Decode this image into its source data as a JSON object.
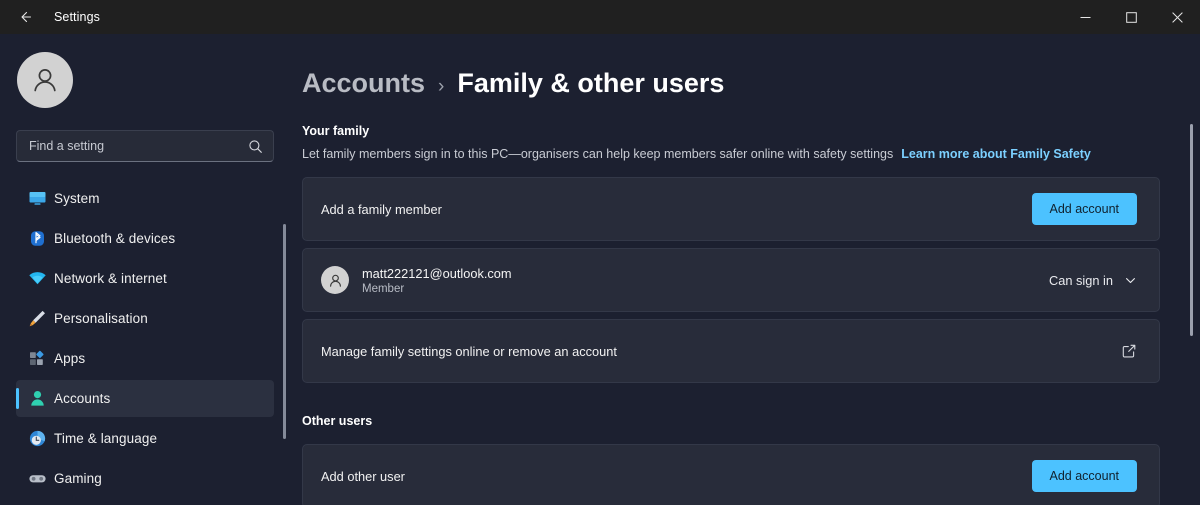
{
  "titlebar": {
    "back_label": "Back",
    "app_title": "Settings",
    "minimize_label": "—",
    "maximize_label": "☐",
    "close_label": "✕"
  },
  "sidebar": {
    "avatar_name": "user-avatar",
    "search": {
      "placeholder": "Find a setting",
      "value": ""
    },
    "items": [
      {
        "label": "System",
        "icon": "system-icon",
        "selected": false
      },
      {
        "label": "Bluetooth & devices",
        "icon": "bluetooth-icon",
        "selected": false
      },
      {
        "label": "Network & internet",
        "icon": "network-icon",
        "selected": false
      },
      {
        "label": "Personalisation",
        "icon": "personalisation-icon",
        "selected": false
      },
      {
        "label": "Apps",
        "icon": "apps-icon",
        "selected": false
      },
      {
        "label": "Accounts",
        "icon": "accounts-icon",
        "selected": true
      },
      {
        "label": "Time & language",
        "icon": "time-icon",
        "selected": false
      },
      {
        "label": "Gaming",
        "icon": "gaming-icon",
        "selected": false
      }
    ]
  },
  "main": {
    "breadcrumb": {
      "parent": "Accounts",
      "separator": "›",
      "current": "Family & other users"
    },
    "your_family": {
      "title": "Your family",
      "description": "Let family members sign in to this PC—organisers can help keep members safer online with safety settings",
      "link": "Learn more about Family Safety",
      "add_member": {
        "label": "Add a family member",
        "button": "Add account"
      },
      "account": {
        "email": "matt222121@outlook.com",
        "role": "Member",
        "status": "Can sign in",
        "chevron": "chevron-down-icon"
      },
      "manage": {
        "label": "Manage family settings online or remove an account",
        "icon": "external-link-icon"
      }
    },
    "other_users": {
      "title": "Other users",
      "add_user": {
        "label": "Add other user",
        "button": "Add account"
      }
    }
  },
  "colors": {
    "accent": "#4cc2ff",
    "link": "#7cd0ff",
    "background": "#1c2030",
    "card": "#282c3a",
    "titlebar": "#202020"
  }
}
